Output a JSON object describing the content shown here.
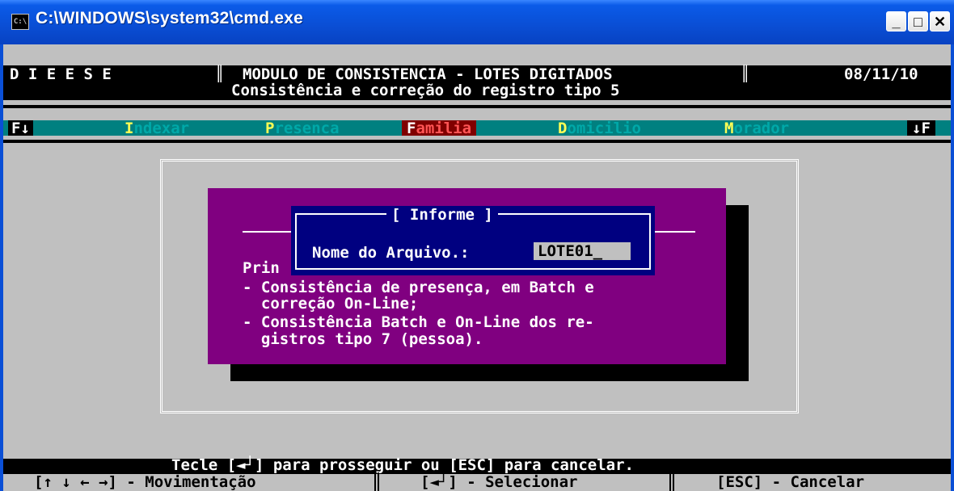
{
  "window": {
    "title": "C:\\WINDOWS\\system32\\cmd.exe",
    "icon_glyph": "C:\\",
    "min_glyph": "_",
    "max_glyph": "□",
    "close_glyph": "✕"
  },
  "header": {
    "left": "D I E E S E",
    "center": "MODULO DE CONSISTENCIA - LOTES DIGITADOS",
    "divider_left": "║",
    "divider_right": "║",
    "date": "08/11/10",
    "subtitle": "Consistência e correção do registro tipo 5"
  },
  "menu": {
    "left_marker": "F↓",
    "right_marker": "↓F",
    "items": [
      {
        "hotkey": "I",
        "rest": "ndexar"
      },
      {
        "hotkey": "P",
        "rest": "resenca"
      },
      {
        "hotkey": "F",
        "rest": "amilia"
      },
      {
        "hotkey": "D",
        "rest": "omicilio"
      },
      {
        "hotkey": "M",
        "rest": "orador"
      }
    ]
  },
  "panel": {
    "line1": "Prin",
    "line2": "- Consistência de presença, em Batch e",
    "line3": "  correção On-Line;",
    "line4": "- Consistência Batch e On-Line dos re-",
    "line5": "  gistros tipo 7 (pessoa)."
  },
  "dialog": {
    "title": "[ Informe ]",
    "label": "Nome do Arquivo.:",
    "value": "LOTE01",
    "cursor": "_"
  },
  "footer": {
    "prompt": "Tecle [◄┘] para prosseguir ou [ESC] para cancelar.",
    "move": "[↑ ↓ ← →] - Movimentação",
    "select": "[◄┘] - Selecionar",
    "cancel": "[ESC] - Cancelar"
  },
  "colors": {
    "console_bg": "#c0c0c0",
    "menu_bg": "#008080",
    "panel_bg": "#800080",
    "dialog_bg": "#000080",
    "selected_menu_bg": "#800000",
    "hotkey": "#ffff55"
  }
}
